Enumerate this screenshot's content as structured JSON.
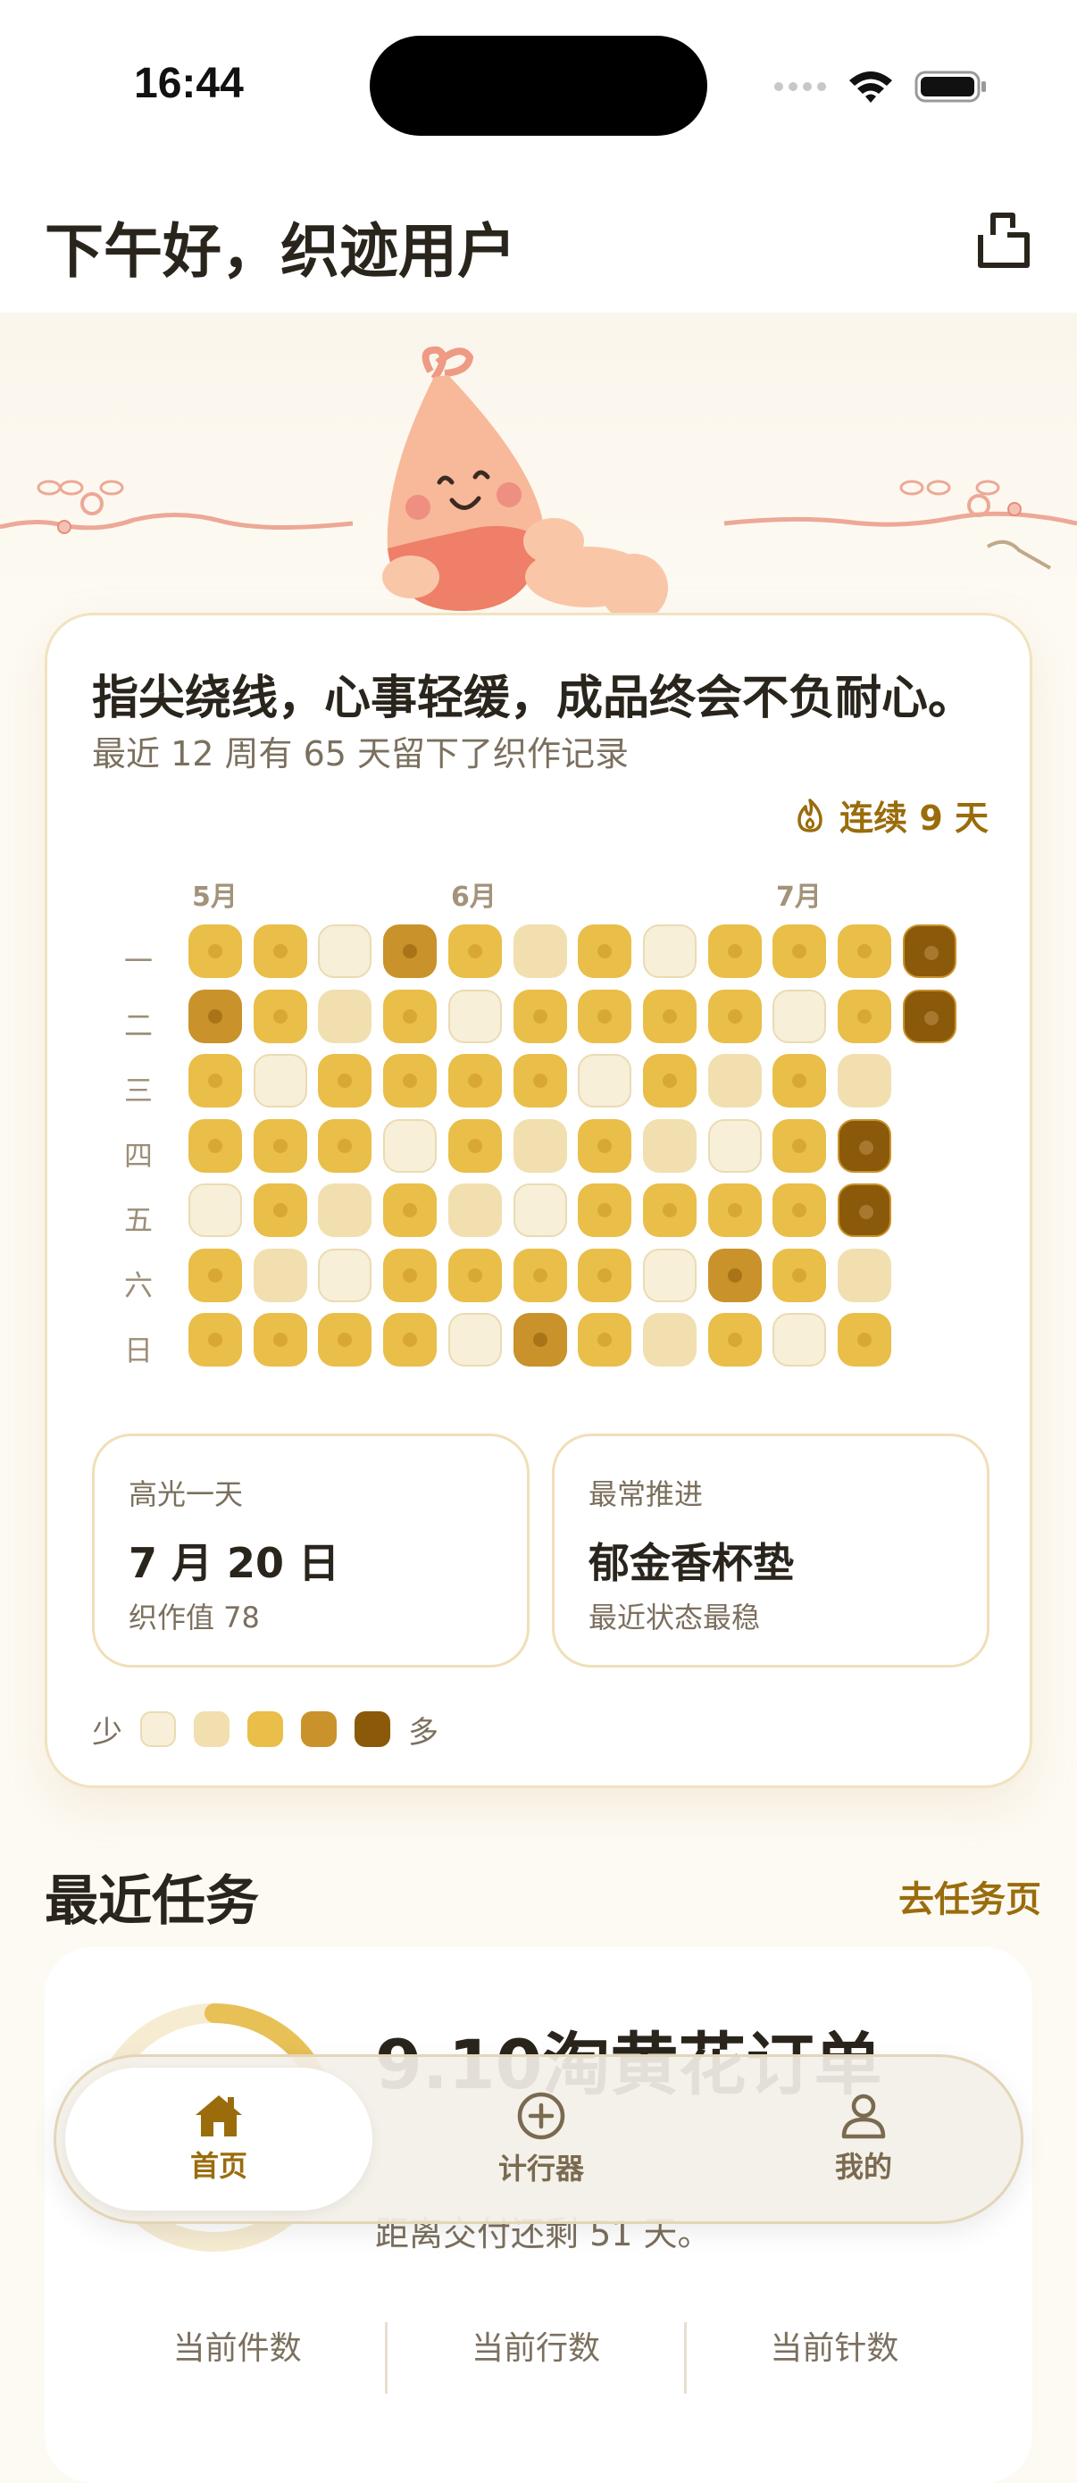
{
  "status_bar": {
    "time": "16:44"
  },
  "header": {
    "greeting": "下午好，织迹用户"
  },
  "card": {
    "quote": "指尖绕线，心事轻缓，成品终会不负耐心。",
    "subtitle": "最近 12 周有 65 天留下了织作记录",
    "streak": "连续 9 天",
    "months": [
      "5月",
      "6月",
      "7月"
    ],
    "days": [
      "一",
      "二",
      "三",
      "四",
      "五",
      "六",
      "日"
    ],
    "heatmap": [
      [
        2,
        2,
        0,
        3,
        2,
        1,
        2,
        0,
        2,
        2,
        2,
        4
      ],
      [
        3,
        2,
        1,
        2,
        0,
        2,
        2,
        2,
        2,
        0,
        2,
        4
      ],
      [
        2,
        0,
        2,
        2,
        2,
        2,
        0,
        2,
        1,
        2,
        1
      ],
      [
        2,
        2,
        2,
        0,
        2,
        1,
        2,
        1,
        0,
        2,
        4
      ],
      [
        0,
        2,
        1,
        2,
        1,
        0,
        2,
        2,
        2,
        2,
        4
      ],
      [
        2,
        1,
        0,
        2,
        2,
        2,
        2,
        0,
        3,
        2,
        1
      ],
      [
        2,
        2,
        2,
        2,
        0,
        3,
        2,
        1,
        2,
        0,
        2
      ]
    ],
    "highlight_day": {
      "label": "高光一天",
      "value": "7 月 20 日",
      "note": "织作值 78"
    },
    "most_progress": {
      "label": "最常推进",
      "value": "郁金香杯垫",
      "note": "最近状态最稳"
    },
    "legend": {
      "less": "少",
      "more": "多"
    }
  },
  "recent_tasks": {
    "title": "最近任务",
    "link": "去任务页",
    "task": {
      "name": "9.10淘黄花订单",
      "deadline": "距离交付还剩 51 天。",
      "stats": [
        "当前件数",
        "当前行数",
        "当前针数"
      ]
    }
  },
  "tabbar": {
    "tabs": [
      {
        "label": "首页",
        "icon": "home-icon",
        "active": true
      },
      {
        "label": "计行器",
        "icon": "plus-circle-icon",
        "active": false
      },
      {
        "label": "我的",
        "icon": "person-icon",
        "active": false
      }
    ]
  }
}
